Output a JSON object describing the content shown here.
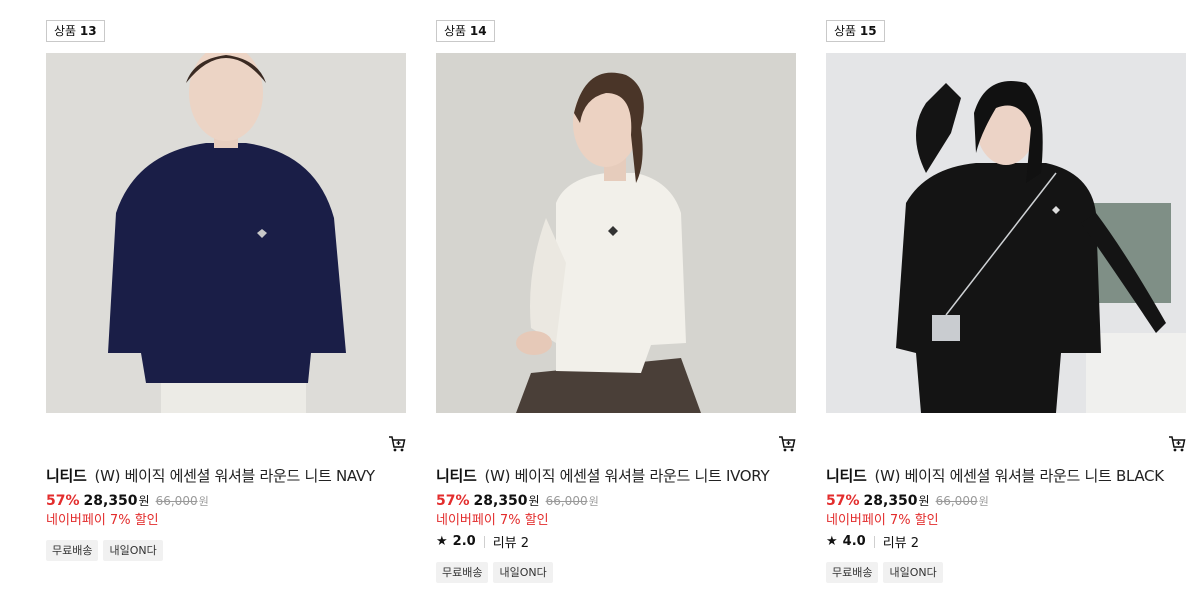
{
  "products": [
    {
      "badge_prefix": "상품",
      "badge_num": "13",
      "brand": "니티드",
      "name": "(W) 베이직 에센셜 워셔블 라운드 니트 NAVY",
      "discount": "57%",
      "sale_price": "28,350",
      "currency": "원",
      "original_price": "66,000",
      "pay_text": "네이버페이 7% 할인",
      "tags": [
        "무료배송",
        "내일ON다"
      ],
      "photo": {
        "bg": "#dddcd8",
        "garment": "#1a1e47",
        "bottom": "#ecebe6",
        "hair": "#3a2a22"
      }
    },
    {
      "badge_prefix": "상품",
      "badge_num": "14",
      "brand": "니티드",
      "name": "(W) 베이직 에센셜 워셔블 라운드 니트 IVORY",
      "discount": "57%",
      "sale_price": "28,350",
      "currency": "원",
      "original_price": "66,000",
      "pay_text": "네이버페이 7% 할인",
      "rating": {
        "score": "2.0",
        "review_label": "리뷰 2"
      },
      "tags": [
        "무료배송",
        "내일ON다"
      ],
      "photo": {
        "bg": "#d5d4cf",
        "garment": "#f2f0ea",
        "bottom": "#4a3f38",
        "hair": "#4a3528"
      }
    },
    {
      "badge_prefix": "상품",
      "badge_num": "15",
      "brand": "니티드",
      "name": "(W) 베이직 에센셜 워셔블 라운드 니트 BLACK",
      "discount": "57%",
      "sale_price": "28,350",
      "currency": "원",
      "original_price": "66,000",
      "pay_text": "네이버페이 7% 할인",
      "rating": {
        "score": "4.0",
        "review_label": "리뷰 2"
      },
      "tags": [
        "무료배송",
        "내일ON다"
      ],
      "photo": {
        "bg": "#e4e5e7",
        "garment": "#141414",
        "bottom": "#1d1d1d",
        "hair": "#111111"
      }
    }
  ],
  "icons": {
    "cart": "cart-icon",
    "star": "star-icon"
  },
  "colors": {
    "discount_red": "#e32d2d",
    "muted_gray": "#9a9a9a",
    "tag_bg": "#f1f1f1"
  }
}
